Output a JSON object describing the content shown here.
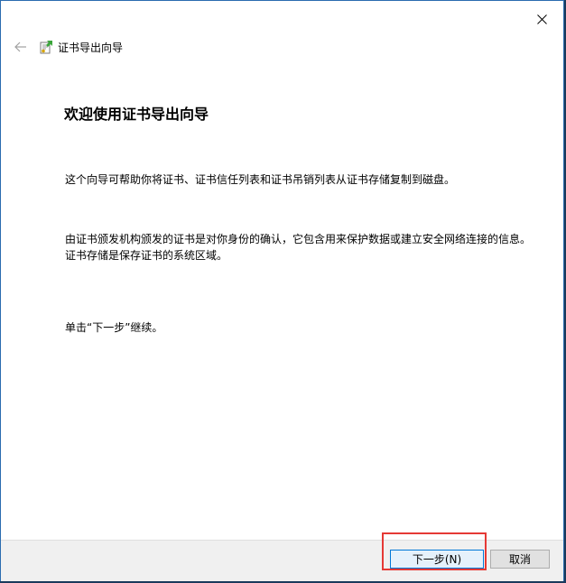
{
  "window": {
    "title": "证书导出向导"
  },
  "header": {
    "back_icon": "back-arrow-icon",
    "cert_icon": "certificate-export-icon"
  },
  "content": {
    "heading": "欢迎使用证书导出向导",
    "paragraph1": "这个向导可帮助你将证书、证书信任列表和证书吊销列表从证书存储复制到磁盘。",
    "paragraph2": "由证书颁发机构颁发的证书是对你身份的确认，它包含用来保护数据或建立安全网络连接的信息。证书存储是保存证书的系统区域。",
    "paragraph3": "单击“下一步”继续。"
  },
  "footer": {
    "next_label": "下一步(N)",
    "cancel_label": "取消"
  },
  "colors": {
    "highlight": "#e53935",
    "window_border": "#2b6cb0",
    "footer_bg": "#f0f0f0"
  }
}
